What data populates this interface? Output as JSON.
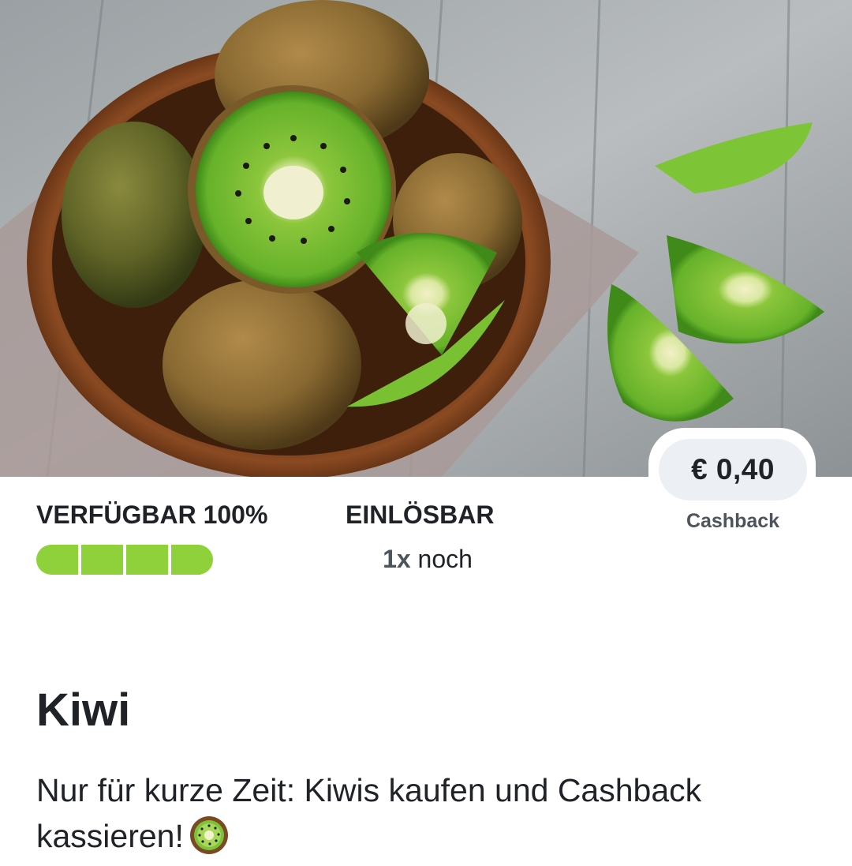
{
  "hero": {
    "image_subject": "kiwi-bowl-photo"
  },
  "cashback": {
    "price": "€ 0,40",
    "label": "Cashback"
  },
  "availability": {
    "title": "VERFÜGBAR 100%",
    "percent": 100,
    "segments": 4
  },
  "redeemable": {
    "title": "EINLÖSBAR",
    "count": "1x",
    "suffix": " noch"
  },
  "product": {
    "title": "Kiwi",
    "description": "Nur für kurze Zeit: Kiwis kaufen und Cashback kassieren!",
    "emoji_icon": "kiwi-emoji-icon"
  },
  "colors": {
    "progress_green": "#8ed13a",
    "pill_background": "#eceff4",
    "text_dark": "#1f2328",
    "text_muted": "#4d545c"
  }
}
